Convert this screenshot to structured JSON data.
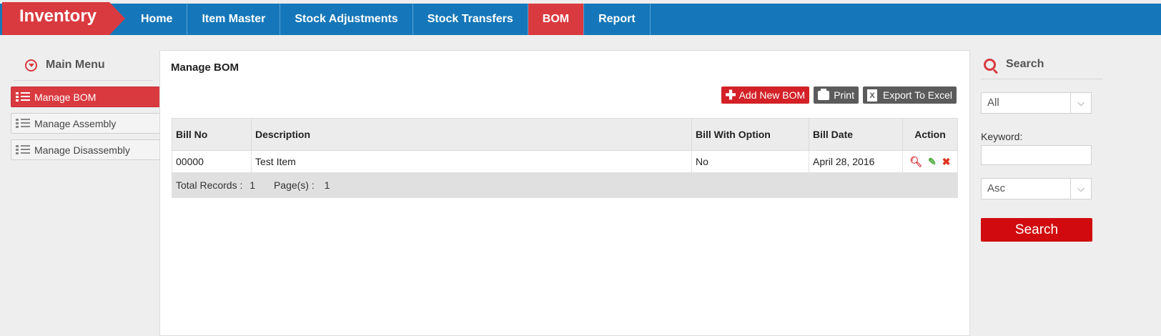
{
  "app": {
    "title": "Inventory"
  },
  "nav": {
    "items": [
      {
        "label": "Home"
      },
      {
        "label": "Item Master"
      },
      {
        "label": "Stock Adjustments"
      },
      {
        "label": "Stock Transfers"
      },
      {
        "label": "BOM",
        "active": true
      },
      {
        "label": "Report"
      }
    ]
  },
  "sidebar": {
    "title": "Main Menu",
    "items": [
      {
        "label": "Manage BOM",
        "active": true
      },
      {
        "label": "Manage Assembly"
      },
      {
        "label": "Manage Disassembly"
      }
    ]
  },
  "main": {
    "title": "Manage BOM",
    "toolbar": {
      "add_label": "Add New BOM",
      "print_label": "Print",
      "export_label": "Export To Excel"
    },
    "table": {
      "headers": [
        "Bill No",
        "Description",
        "Bill With Option",
        "Bill Date",
        "Action"
      ],
      "rows": [
        {
          "bill_no": "00000",
          "description": "Test Item",
          "bill_with_option": "No",
          "bill_date": "April 28, 2016"
        }
      ],
      "footer": {
        "total_label": "Total Records :",
        "total_value": "1",
        "pages_label": "Page(s) :",
        "pages_value": "1"
      }
    }
  },
  "search": {
    "title": "Search",
    "filter_value": "All",
    "keyword_label": "Keyword:",
    "keyword_value": "",
    "order_value": "Asc",
    "button_label": "Search"
  },
  "colors": {
    "nav_bg": "#1577b9",
    "accent_red": "#d93a3f",
    "button_red": "#d00a0e"
  }
}
